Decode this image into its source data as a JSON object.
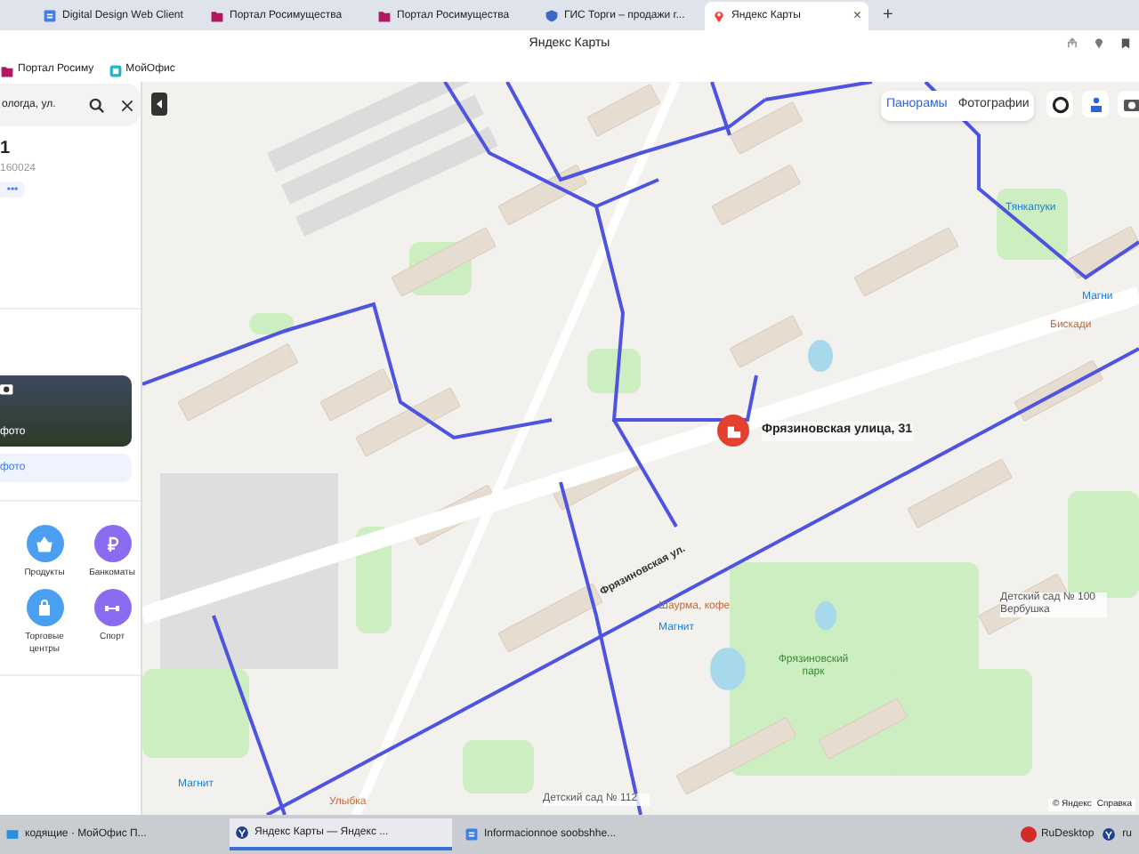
{
  "browser": {
    "tabs": [
      {
        "label": "Digital Design Web Client",
        "selected": false,
        "kind": "doc"
      },
      {
        "label": "Портал Росимущества",
        "selected": false,
        "kind": "folder"
      },
      {
        "label": "Портал Росимущества",
        "selected": false,
        "kind": "folder"
      },
      {
        "label": "ГИС Торги – продажи г...",
        "selected": false,
        "kind": "shield"
      },
      {
        "label": "Яндекс Карты",
        "selected": true,
        "kind": "pin"
      }
    ],
    "new_tab": "+",
    "close": "×",
    "title": "Яндекс Карты",
    "bookmarks": [
      {
        "label": "Портал Росиму",
        "kind": "folder"
      },
      {
        "label": "МойОфис",
        "kind": "office"
      }
    ]
  },
  "left_panel": {
    "search_value": "ологда, ул.",
    "title": "1",
    "postcode": "160024",
    "more": "•••",
    "photo_caption": "фото",
    "photos_link": "фото",
    "categories": [
      {
        "label": "Продукты",
        "color": "#4b9ff0",
        "kind": "basket"
      },
      {
        "label": "Банкоматы",
        "color": "#8b6cf0",
        "kind": "ruble"
      },
      {
        "label": "Торговые центры",
        "color": "#4b9ff0",
        "kind": "bag"
      },
      {
        "label": "Спорт",
        "color": "#8b6cf0",
        "kind": "dumbbell"
      }
    ]
  },
  "map": {
    "view_tabs": [
      {
        "label": "Панорамы",
        "selected": true
      },
      {
        "label": "Фотографии",
        "selected": false
      }
    ],
    "address_label": "Фрязиновская улица, 31",
    "labels": [
      {
        "text": "Фрязиновская ул.",
        "kind": "street"
      },
      {
        "text": "Шаурма, кофе",
        "kind": "cafe"
      },
      {
        "text": "Магнит",
        "kind": "shop"
      },
      {
        "text": "Фрязиновский парк",
        "kind": "park"
      },
      {
        "text": "Тянкапуки",
        "kind": "shop"
      },
      {
        "text": "Магни",
        "kind": "shop"
      },
      {
        "text": "Бискади",
        "kind": "cafe"
      },
      {
        "text": "Детский сад № 100 Вербушка",
        "kind": "place"
      },
      {
        "text": "Улыбка",
        "kind": "cafe"
      },
      {
        "text": "Магнит",
        "kind": "shop"
      },
      {
        "text": "Детский сад № 112",
        "kind": "place"
      }
    ],
    "copyright": "© Яндекс",
    "help": "Справка"
  },
  "taskbar": {
    "items": [
      {
        "label": "кодящие · МойОфис П...",
        "selected": false,
        "kind": "mail"
      },
      {
        "label": "Яндекс Карты — Яндекс ...",
        "selected": true,
        "kind": "browser"
      },
      {
        "label": "Informacionnoe soobshhe...",
        "selected": false,
        "kind": "doc"
      }
    ],
    "tray_app": "RuDesktop",
    "language": "ru"
  }
}
